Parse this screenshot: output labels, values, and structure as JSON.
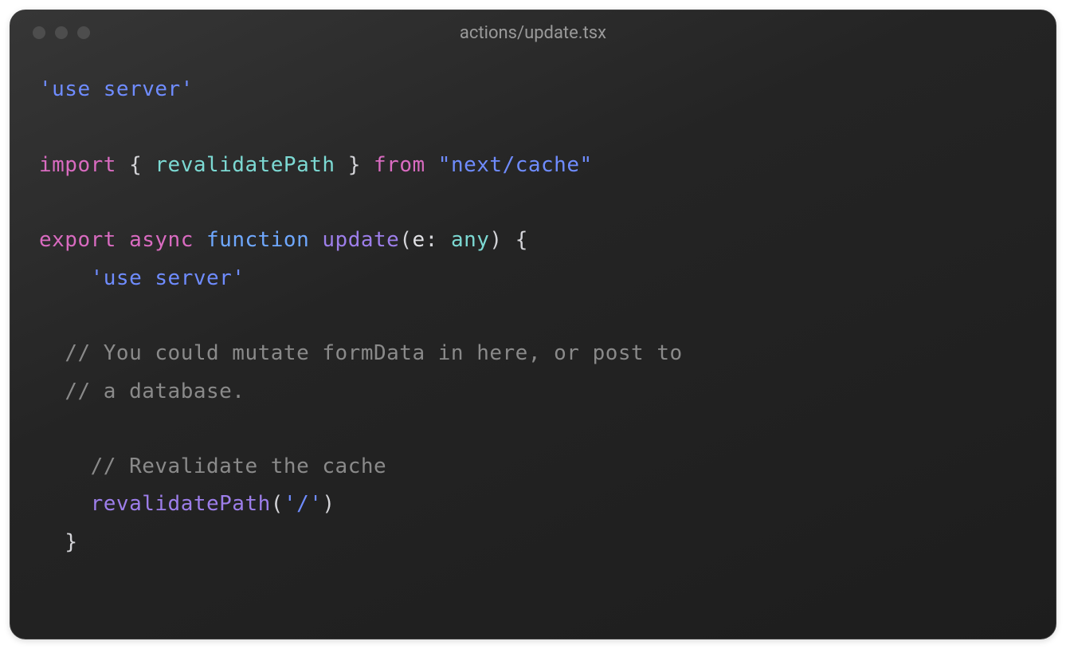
{
  "window": {
    "filename": "actions/update.tsx"
  },
  "code": {
    "l1_directive": "'use server'",
    "l3_import": "import",
    "l3_brace_open": " { ",
    "l3_ident": "revalidatePath",
    "l3_brace_close": " } ",
    "l3_from": "from",
    "l3_sp": " ",
    "l3_source": "\"next/cache\"",
    "l5_export": "export",
    "l5_sp1": " ",
    "l5_async": "async",
    "l5_sp2": " ",
    "l5_function": "function",
    "l5_sp3": " ",
    "l5_name": "update",
    "l5_paren_open": "(",
    "l5_param": "e",
    "l5_colon": ": ",
    "l5_type": "any",
    "l5_paren_close": ")",
    "l5_sp4": " ",
    "l5_brace": "{",
    "l6_indent": "    ",
    "l6_directive": "'use server'",
    "l8_indent": "  ",
    "l8_comment": "// You could mutate formData in here, or post to",
    "l9_indent": "  ",
    "l9_comment": "// a database.",
    "l11_indent": "    ",
    "l11_comment": "// Revalidate the cache",
    "l12_indent": "    ",
    "l12_call": "revalidatePath",
    "l12_paren_open": "(",
    "l12_arg": "'/'",
    "l12_paren_close": ")",
    "l13_indent": "  ",
    "l13_brace": "}"
  }
}
